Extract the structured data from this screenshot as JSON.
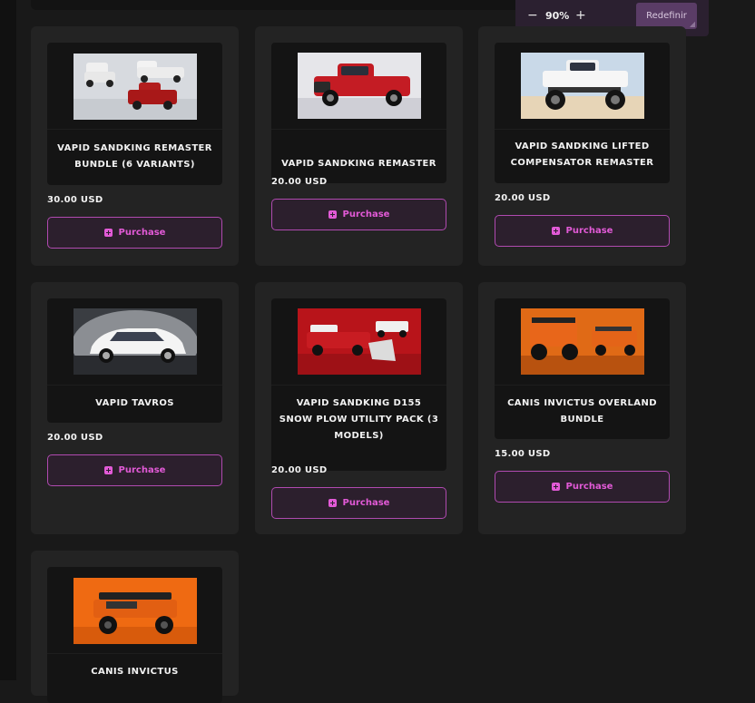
{
  "zoom": {
    "minus": "−",
    "value": "90%",
    "plus": "+",
    "reset_label": "Redefinir"
  },
  "purchase_label": "Purchase",
  "products": [
    {
      "title": "VAPID SANDKING REMASTER BUNDLE (6 VARIANTS)",
      "price": "30.00 USD"
    },
    {
      "title": "VAPID SANDKING REMASTER",
      "price": "20.00 USD"
    },
    {
      "title": "VAPID SANDKING LIFTED COMPENSATOR REMASTER",
      "price": "20.00 USD"
    },
    {
      "title": "VAPID TAVROS",
      "price": "20.00 USD"
    },
    {
      "title": "VAPID SANDKING D155 SNOW PLOW UTILITY PACK (3 MODELS)",
      "price": "20.00 USD"
    },
    {
      "title": "CANIS INVICTUS OVERLAND BUNDLE",
      "price": "15.00 USD"
    },
    {
      "title": "CANIS INVICTUS",
      "price": ""
    }
  ],
  "colors": {
    "accent": "#e25ad7",
    "background": "#191919",
    "card": "#232323"
  }
}
